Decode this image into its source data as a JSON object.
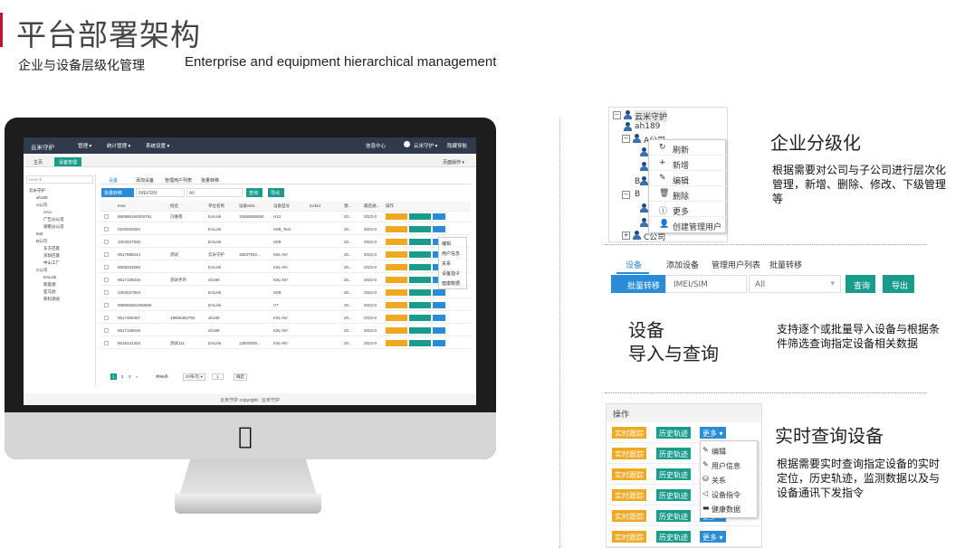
{
  "header": {
    "title": "平台部署架构",
    "subtitle_cn": "企业与设备层级化管理",
    "subtitle_en": "Enterprise and equipment hierarchical management",
    "accent_color": "#c8102e"
  },
  "screen": {
    "app_name": "云米守护",
    "top_menu": [
      "管理 ▾",
      "统计管理 ▾",
      "系统设置 ▾"
    ],
    "top_right": [
      "信息中心",
      "云米守护 ▾",
      "隐藏导航"
    ],
    "tabs": [
      "主页",
      "设备管理"
    ],
    "page_ops": "页面操作 ▾",
    "search_placeholder": "Search",
    "tree": [
      "云米守护",
      "ah189",
      "A公司",
      "AAA",
      "广告分公司",
      "湖南分公司",
      "test",
      "B公司",
      "东方巴基",
      "深圳巴基",
      "中山工厂",
      "C公司",
      "EALink",
      "新能源",
      "亚马逊",
      "移科测试"
    ],
    "sub_tabs": [
      "设备",
      "添加设备",
      "管理用户列表",
      "批量转移"
    ],
    "bulk_button": "批量转移",
    "imei_placeholder": "IMEI/SIM",
    "select_value": "All",
    "query_button": "查询",
    "export_button": "导出",
    "columns": [
      "Imei",
      "姓名",
      "单位名称",
      "设备SIM...",
      "设备型号",
      "lockId",
      "激...",
      "最后通...",
      "操作"
    ],
    "rows": [
      [
        "860995184829791",
        "冯维南",
        "EALink",
        "15555555555",
        "H12",
        "",
        "20...",
        "2022-0"
      ],
      [
        "0100002594",
        "",
        "EALink",
        "",
        "H08_Test",
        "",
        "20...",
        "2022-0"
      ],
      [
        "2304027830",
        "",
        "EALink",
        "",
        "H09",
        "",
        "20...",
        "2022-0"
      ],
      [
        "9517888244",
        "测试",
        "云米守护",
        "18037932...",
        "K9L-NV",
        "",
        "20...",
        "2022-0"
      ],
      [
        "6505254555",
        "",
        "EALink",
        "",
        "K9L-NV",
        "",
        "20...",
        "2022-0"
      ],
      [
        "9517138316",
        "测试手环",
        "ah189",
        "",
        "K9L-NV",
        "",
        "20...",
        "2022-0"
      ],
      [
        "2304027804",
        "",
        "EALink",
        "",
        "H09",
        "",
        "20...",
        "2022-0"
      ],
      [
        "998555661093606",
        "",
        "EALink",
        "",
        "V7",
        "",
        "20...",
        "2022-0"
      ],
      [
        "9517465357",
        "19656382752",
        "ah189",
        "",
        "K9L-NV",
        "",
        "20...",
        "2022-0"
      ],
      [
        "9517138049",
        "",
        "ah189",
        "",
        "K9L-NV",
        "",
        "20...",
        "2022-0"
      ],
      [
        "9518141303",
        "测试111",
        "EALink",
        "13800000...",
        "K9L-NV",
        "",
        "20...",
        "2022-0"
      ]
    ],
    "mini_menu": [
      "编辑",
      "用户信息",
      "关系",
      "设备指令",
      "健康数据"
    ],
    "pagination": [
      "1",
      "2",
      "3",
      "»",
      "共96条",
      "20条/页 ▾",
      "1",
      "确定"
    ],
    "footer": "云米守护 copyright : 云米守护"
  },
  "panel1": {
    "tree": [
      "云米守护",
      "ah189",
      "A公司",
      "B",
      "B",
      "C公司"
    ],
    "menu": [
      {
        "icon": "↻",
        "label": "刷新"
      },
      {
        "icon": "+",
        "label": "新增"
      },
      {
        "icon": "✎",
        "label": "编辑"
      },
      {
        "icon": "🗑",
        "label": "删除"
      },
      {
        "icon": "ⓘ",
        "label": "更多"
      },
      {
        "icon": "👤",
        "label": "创建管理用户"
      }
    ],
    "heading": "企业分级化",
    "desc": "根据需要对公司与子公司进行层次化管理，新增、删除、修改、下级管理等"
  },
  "panel2": {
    "tabs": [
      "设备",
      "添加设备",
      "管理用户列表",
      "批量转移"
    ],
    "bulk_button": "批量转移",
    "imei_placeholder": "IMEI/SIM",
    "select_value": "All",
    "query_button": "查询",
    "export_button": "导出",
    "heading_line1": "设备",
    "heading_line2": "导入与查询",
    "desc": "支持逐个或批量导入设备与根据条件筛选查询指定设备相关数据"
  },
  "panel3": {
    "column": "操作",
    "btn_track": "实时跟踪",
    "btn_history": "历史轨迹",
    "btn_more": "更多 ▾",
    "menu": [
      {
        "icon": "✎",
        "label": "编辑"
      },
      {
        "icon": "✎",
        "label": "用户信息"
      },
      {
        "icon": "⛁",
        "label": "关系"
      },
      {
        "icon": "◁",
        "label": "设备指令"
      },
      {
        "icon": "▬",
        "label": "健康数据"
      }
    ],
    "heading": "实时查询设备",
    "desc": "根据需要实时查询指定设备的实时定位，历史轨迹，监测数据以及与设备通讯下发指令"
  }
}
